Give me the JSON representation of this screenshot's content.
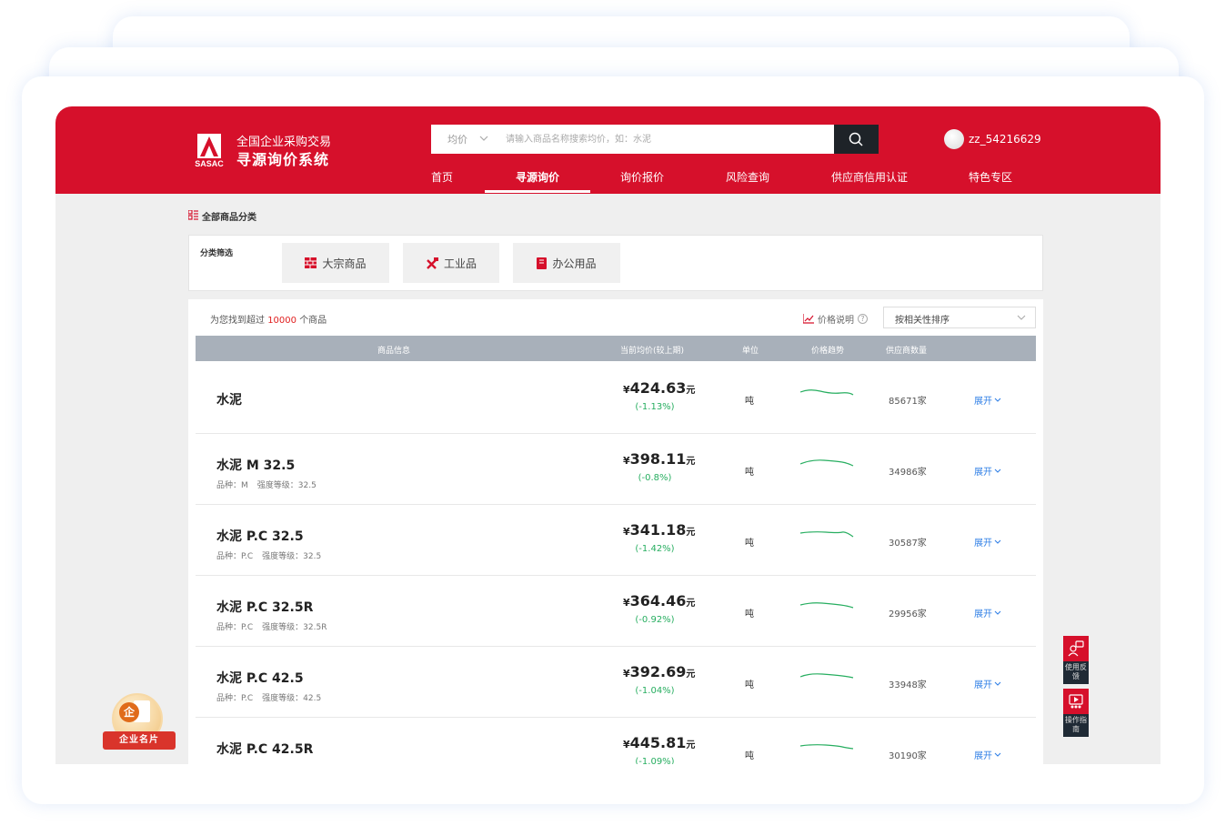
{
  "brand": {
    "logo_text": "SASAC",
    "line1": "全国企业采购交易",
    "line2": "寻源询价系统"
  },
  "search": {
    "type_label": "均价",
    "placeholder": "请输入商品名称搜索均价，如：水泥"
  },
  "user": {
    "name": "zz_54216629"
  },
  "nav": {
    "items": [
      {
        "label": "首页"
      },
      {
        "label": "寻源询价"
      },
      {
        "label": "询价报价"
      },
      {
        "label": "风险查询"
      },
      {
        "label": "供应商信用认证"
      },
      {
        "label": "特色专区"
      }
    ],
    "active_index": 1
  },
  "category": {
    "title": "全部商品分类",
    "filter_label": "分类筛选",
    "chips": [
      {
        "label": "大宗商品",
        "icon": "bricks-icon"
      },
      {
        "label": "工业品",
        "icon": "tools-icon"
      },
      {
        "label": "办公用品",
        "icon": "book-icon"
      }
    ]
  },
  "results": {
    "prefix": "为您找到超过",
    "count": "10000",
    "suffix": "个商品",
    "price_note": "价格说明",
    "sort_label": "按相关性排序",
    "columns": [
      "商品信息",
      "当前均价(较上期)",
      "单位",
      "价格趋势",
      "供应商数量"
    ],
    "currency": "¥",
    "yuan": "元",
    "expand_label": "展开",
    "rows": [
      {
        "name": "水泥",
        "attrs": [],
        "price": "424.63",
        "change": "(-1.13%)",
        "unit": "吨",
        "suppliers": "85671家"
      },
      {
        "name": "水泥 M 32.5",
        "attrs": [
          "品种：M",
          "强度等级：32.5"
        ],
        "price": "398.11",
        "change": "(-0.8%)",
        "unit": "吨",
        "suppliers": "34986家"
      },
      {
        "name": "水泥 P.C 32.5",
        "attrs": [
          "品种：P.C",
          "强度等级：32.5"
        ],
        "price": "341.18",
        "change": "(-1.42%)",
        "unit": "吨",
        "suppliers": "30587家"
      },
      {
        "name": "水泥 P.C 32.5R",
        "attrs": [
          "品种：P.C",
          "强度等级：32.5R"
        ],
        "price": "364.46",
        "change": "(-0.92%)",
        "unit": "吨",
        "suppliers": "29956家"
      },
      {
        "name": "水泥 P.C 42.5",
        "attrs": [
          "品种：P.C",
          "强度等级：42.5"
        ],
        "price": "392.69",
        "change": "(-1.04%)",
        "unit": "吨",
        "suppliers": "33948家"
      },
      {
        "name": "水泥 P.C 42.5R",
        "attrs": [],
        "price": "445.81",
        "change": "(-1.09%)",
        "unit": "吨",
        "suppliers": "30190家"
      }
    ]
  },
  "side": {
    "feedback": "使用反馈",
    "guide": "操作指南"
  },
  "badge": {
    "qi": "企",
    "ribbon": "企业名片"
  },
  "colors": {
    "brand_red": "#d6102b",
    "trend_green": "#27ae60",
    "link_blue": "#2f7fe6",
    "highlight_red": "#e02020"
  }
}
